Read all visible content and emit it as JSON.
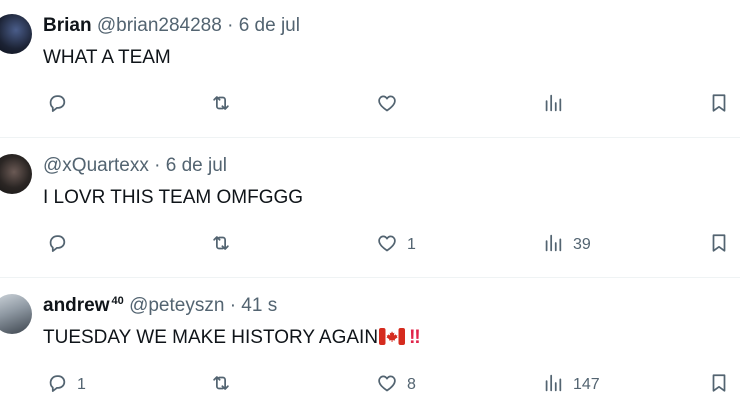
{
  "tweets": [
    {
      "name": "Brian",
      "name_sup": "",
      "handle": "@brian284288",
      "separator": "·",
      "time": "6 de jul",
      "text": "WHAT A TEAM",
      "reply_count": "",
      "retweet_count": "",
      "like_count": "",
      "view_count": ""
    },
    {
      "name": "",
      "name_sup": "",
      "handle": "@xQuartexx",
      "separator": "·",
      "time": "6 de jul",
      "text": "I LOVR THIS TEAM OMFGGG",
      "reply_count": "",
      "retweet_count": "",
      "like_count": "1",
      "view_count": "39"
    },
    {
      "name": "andrew",
      "name_sup": "40",
      "handle": "@peteyszn",
      "separator": "·",
      "time": "41 s",
      "text": "TUESDAY WE MAKE HISTORY AGAIN",
      "emoji_flag": "canada-flag",
      "emoji_bang": "‼",
      "reply_count": "1",
      "retweet_count": "",
      "like_count": "8",
      "view_count": "147"
    }
  ],
  "icons": {
    "reply": "reply-icon",
    "retweet": "retweet-icon",
    "like": "like-icon",
    "views": "views-icon",
    "bookmark": "bookmark-icon"
  },
  "colors": {
    "text": "#0f1419",
    "secondary": "#536471",
    "divider": "#eff3f4",
    "flag_red": "#d52b1e",
    "bang_red": "#e0244a"
  }
}
